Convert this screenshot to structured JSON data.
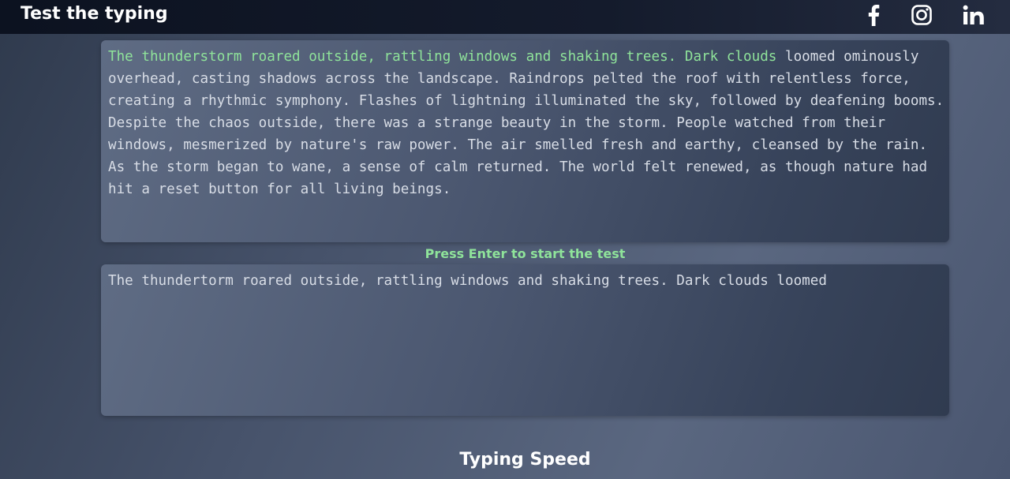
{
  "header": {
    "title": "Test the typing",
    "social": [
      {
        "name": "facebook-icon"
      },
      {
        "name": "instagram-icon"
      },
      {
        "name": "linkedin-icon"
      }
    ]
  },
  "passage": {
    "correct": "The thunderstorm roared outside, rattling windows and shaking trees. Dark clouds",
    "remaining": " loomed ominously overhead, casting shadows across the landscape. Raindrops pelted the roof with relentless force, creating a rhythmic symphony. Flashes of lightning illuminated the sky, followed by deafening booms. Despite the chaos outside, there was a strange beauty in the storm. People watched from their windows, mesmerized by nature's raw power. The air smelled fresh and earthy, cleansed by the rain. As the storm began to wane, a sense of calm returned. The world felt renewed, as though nature had hit a reset button for all living beings."
  },
  "hint": "Press Enter to start the test",
  "input": {
    "value": "The thundertorm roared outside, rattling windows and shaking trees. Dark clouds loomed"
  },
  "results": {
    "heading": "Typing Speed"
  },
  "colors": {
    "correct": "#8fe39a",
    "text": "#d8dde6",
    "header_bg": "#0c1220"
  }
}
